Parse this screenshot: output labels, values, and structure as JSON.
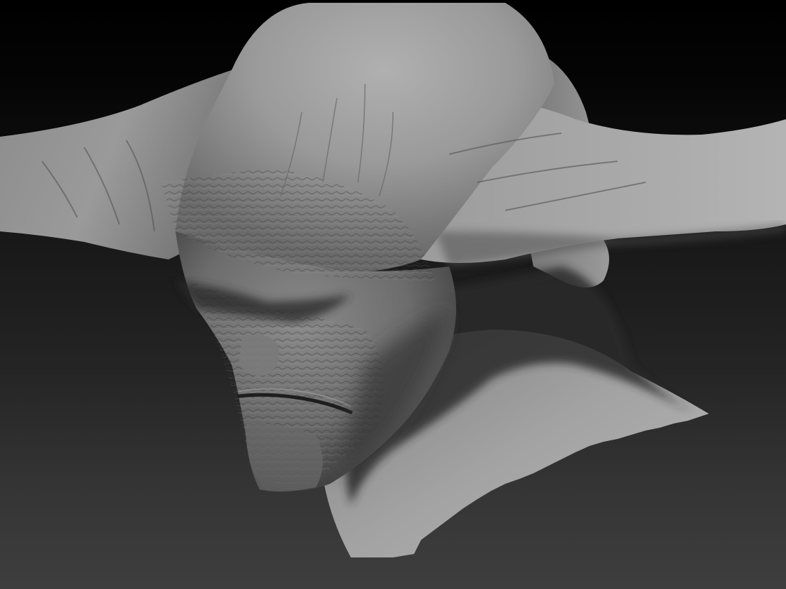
{
  "scene": {
    "subject": "sculpted-creature-head",
    "material": "matcap-grey",
    "colors": {
      "background_top": "#000000",
      "background_bottom": "#3e3e3e",
      "skin_light": "#bdbdbd",
      "skin_mid": "#8a8a8a",
      "skin_dark": "#3a3a3a",
      "shadow": "#1c1c1c"
    }
  }
}
